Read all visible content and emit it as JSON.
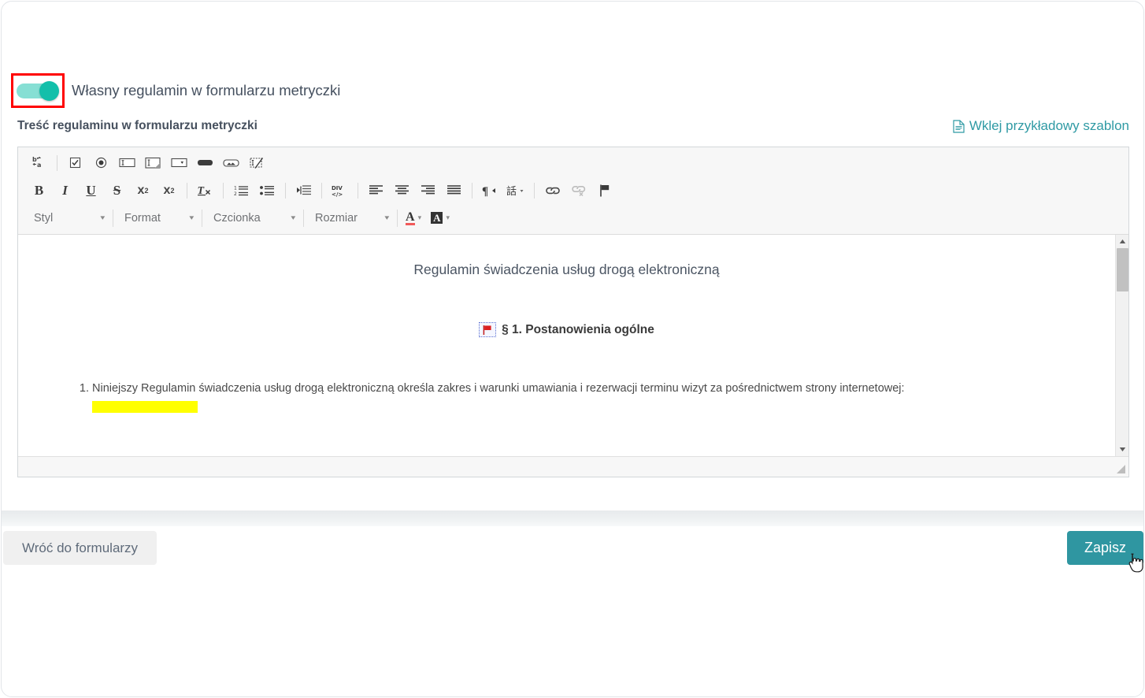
{
  "colors": {
    "accent_teal": "#2f96a1",
    "toggle_on": "#13bfaa",
    "toggle_track": "#86dfd4",
    "annotation_red": "#ff0000",
    "link_teal": "#2f9aa4",
    "highlight_yellow": "#ffff00",
    "flag_red": "#d32020"
  },
  "toggle": {
    "state": "on",
    "label": "Własny regulamin w formularzu metryczki"
  },
  "field": {
    "label": "Treść regulaminu w formularzu metryczki",
    "template_link": "Wklej przykładowy szablon"
  },
  "toolbar": {
    "row1": [
      {
        "name": "replace-icon",
        "title": "Zamień"
      },
      {
        "name": "checkbox-icon",
        "title": "Pole wyboru"
      },
      {
        "name": "radio-button-icon",
        "title": "Przycisk opcji"
      },
      {
        "name": "text-field-icon",
        "title": "Pole tekstowe"
      },
      {
        "name": "textarea-icon",
        "title": "Obszar tekstowy"
      },
      {
        "name": "select-field-icon",
        "title": "Lista wyboru"
      },
      {
        "name": "button-icon",
        "title": "Przycisk"
      },
      {
        "name": "image-button-icon",
        "title": "Przycisk obrazkowy"
      },
      {
        "name": "hidden-field-icon",
        "title": "Pole ukryte"
      }
    ],
    "row2": [
      {
        "name": "bold-icon",
        "label": "B",
        "title": "Pogrubienie"
      },
      {
        "name": "italic-icon",
        "label": "I",
        "title": "Kursywa"
      },
      {
        "name": "underline-icon",
        "label": "U",
        "title": "Podkreślenie"
      },
      {
        "name": "strikethrough-icon",
        "label": "S",
        "title": "Przekreślenie"
      },
      {
        "name": "subscript-icon",
        "label": "x",
        "title": "Indeks dolny"
      },
      {
        "name": "superscript-icon",
        "label": "x",
        "title": "Indeks górny"
      },
      {
        "name": "remove-format-icon",
        "label": "Tx",
        "title": "Usuń formatowanie"
      },
      {
        "name": "numbered-list-icon",
        "title": "Lista numerowana"
      },
      {
        "name": "bulleted-list-icon",
        "title": "Lista wypunktowana"
      },
      {
        "name": "indent-icon",
        "title": "Zwiększ wcięcie"
      },
      {
        "name": "div-container-icon",
        "label": "DIV",
        "title": "Utwórz kontener DIV"
      },
      {
        "name": "align-left-icon",
        "title": "Wyrównaj do lewej"
      },
      {
        "name": "align-center-icon",
        "title": "Wyśrodkuj"
      },
      {
        "name": "align-right-icon",
        "title": "Wyrównaj do prawej"
      },
      {
        "name": "justify-icon",
        "title": "Wyjustuj"
      },
      {
        "name": "text-direction-rtl-icon",
        "title": "Kierunek tekstu od prawej do lewej"
      },
      {
        "name": "language-icon",
        "title": "Ustaw język"
      },
      {
        "name": "link-icon",
        "title": "Wstaw odnośnik"
      },
      {
        "name": "unlink-icon",
        "title": "Usuń odnośnik"
      },
      {
        "name": "anchor-flag-icon",
        "title": "Wstaw kotwicę"
      }
    ],
    "row3": {
      "styl": "Styl",
      "format": "Format",
      "czcionka": "Czcionka",
      "rozmiar": "Rozmiar",
      "text_color": "A",
      "bg_color": "A"
    }
  },
  "document": {
    "title": "Regulamin świadczenia usług drogą elektroniczną",
    "heading": "§ 1. Postanowienia ogólne",
    "list": [
      "Niniejszy Regulamin świadczenia usług drogą elektroniczną określa zakres i warunki umawiania i rezerwacji terminu wizyt za pośrednictwem strony internetowej:"
    ]
  },
  "footer": {
    "back_label": "Wróć do formularzy",
    "save_label": "Zapisz"
  }
}
